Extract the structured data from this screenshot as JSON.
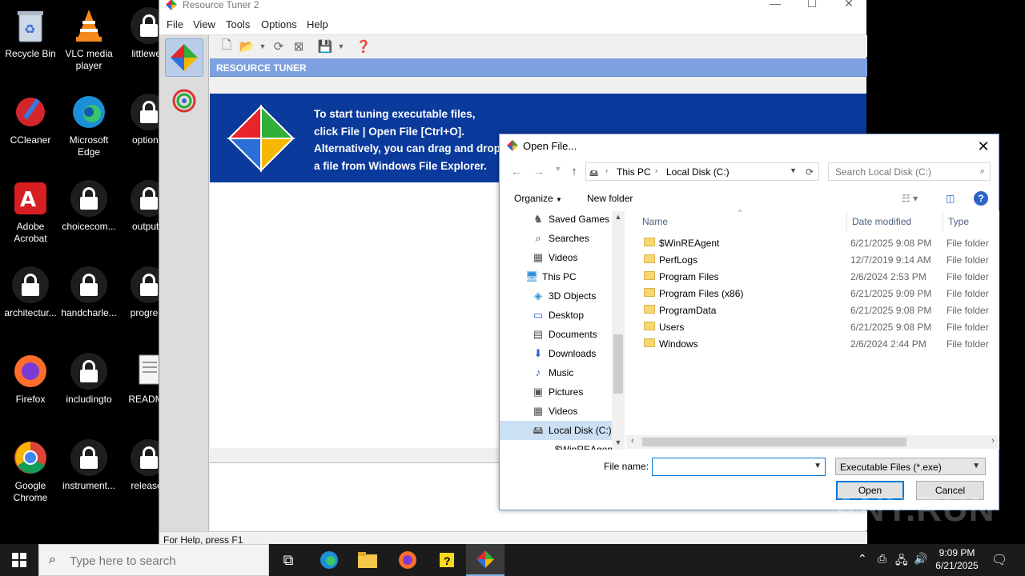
{
  "desktop": {
    "icons": [
      {
        "label": "Recycle Bin",
        "kind": "recycle"
      },
      {
        "label": "VLC media player",
        "kind": "vlc"
      },
      {
        "label": "littleweb",
        "kind": "lock"
      },
      {
        "label": "CCleaner",
        "kind": "ccleaner"
      },
      {
        "label": "Microsoft Edge",
        "kind": "edge"
      },
      {
        "label": "optional",
        "kind": "lock"
      },
      {
        "label": "Adobe Acrobat",
        "kind": "acrobat"
      },
      {
        "label": "choicecom...",
        "kind": "lock"
      },
      {
        "label": "outputvi",
        "kind": "lock"
      },
      {
        "label": "architectur...",
        "kind": "lock"
      },
      {
        "label": "handcharle...",
        "kind": "lock"
      },
      {
        "label": "progress",
        "kind": "lock"
      },
      {
        "label": "Firefox",
        "kind": "firefox"
      },
      {
        "label": "includingto",
        "kind": "lock"
      },
      {
        "label": "README",
        "kind": "doc"
      },
      {
        "label": "Google Chrome",
        "kind": "chrome"
      },
      {
        "label": "instrument...",
        "kind": "lock"
      },
      {
        "label": "releases",
        "kind": "lock"
      }
    ]
  },
  "app": {
    "title": "Resource Tuner 2",
    "menu": [
      "File",
      "View",
      "Tools",
      "Options",
      "Help"
    ],
    "header": "RESOURCE TUNER",
    "banner_lines": [
      "To start tuning executable files,",
      "click File | Open File [Ctrl+O].",
      "Alternatively, you can drag and drop",
      "a file from Windows File Explorer."
    ],
    "status": "For Help, press F1"
  },
  "dialog": {
    "title": "Open File...",
    "address": [
      "This PC",
      "Local Disk (C:)"
    ],
    "search_placeholder": "Search Local Disk (C:)",
    "organize": "Organize",
    "new_folder": "New folder",
    "tree": [
      {
        "label": "Saved Games",
        "icon": "saved-games-icon",
        "indent": 1
      },
      {
        "label": "Searches",
        "icon": "search-icon",
        "indent": 1
      },
      {
        "label": "Videos",
        "icon": "videos-icon",
        "indent": 1
      },
      {
        "label": "This PC",
        "icon": "computer-icon",
        "indent": 0
      },
      {
        "label": "3D Objects",
        "icon": "3d-objects-icon",
        "indent": 1
      },
      {
        "label": "Desktop",
        "icon": "desktop-icon",
        "indent": 1
      },
      {
        "label": "Documents",
        "icon": "documents-icon",
        "indent": 1
      },
      {
        "label": "Downloads",
        "icon": "downloads-icon",
        "indent": 1
      },
      {
        "label": "Music",
        "icon": "music-icon",
        "indent": 1
      },
      {
        "label": "Pictures",
        "icon": "pictures-icon",
        "indent": 1
      },
      {
        "label": "Videos",
        "icon": "videos-icon",
        "indent": 1
      },
      {
        "label": "Local Disk (C:)",
        "icon": "drive-icon",
        "indent": 1,
        "selected": true
      },
      {
        "label": "$WinREAgent",
        "icon": "folder-icon",
        "indent": 2
      }
    ],
    "columns": [
      "Name",
      "Date modified",
      "Type"
    ],
    "files": [
      {
        "name": "$WinREAgent",
        "date": "6/21/2025 9:08 PM",
        "type": "File folder"
      },
      {
        "name": "PerfLogs",
        "date": "12/7/2019 9:14 AM",
        "type": "File folder"
      },
      {
        "name": "Program Files",
        "date": "2/6/2024 2:53 PM",
        "type": "File folder"
      },
      {
        "name": "Program Files (x86)",
        "date": "6/21/2025 9:09 PM",
        "type": "File folder"
      },
      {
        "name": "ProgramData",
        "date": "6/21/2025 9:08 PM",
        "type": "File folder"
      },
      {
        "name": "Users",
        "date": "6/21/2025 9:08 PM",
        "type": "File folder"
      },
      {
        "name": "Windows",
        "date": "2/6/2024 2:44 PM",
        "type": "File folder"
      }
    ],
    "file_name_label": "File name:",
    "file_name_value": "",
    "file_type": "Executable Files (*.exe)",
    "open": "Open",
    "cancel": "Cancel"
  },
  "taskbar": {
    "search_placeholder": "Type here to search",
    "time": "9:09 PM",
    "date": "6/21/2025"
  },
  "watermark": "ANY.RUN"
}
